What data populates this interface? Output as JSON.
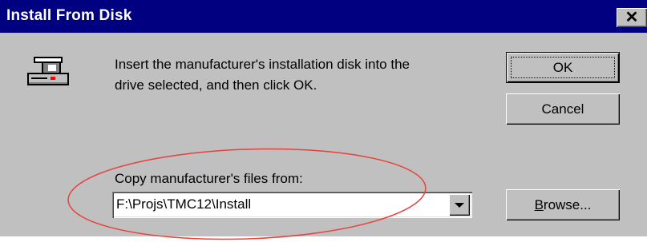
{
  "dialog": {
    "title": "Install From Disk",
    "close_label": "✕"
  },
  "message": "Insert the manufacturer's installation disk into the\ndrive selected, and then click OK.",
  "buttons": {
    "ok": "OK",
    "cancel": "Cancel",
    "browse_underlined": "B",
    "browse_rest": "rowse..."
  },
  "copy_from": {
    "label": "Copy manufacturer's files from:",
    "value": "F:\\Projs\\TMC12\\Install"
  },
  "icons": [
    "disk-drive-icon",
    "close-icon",
    "dropdown-arrow-icon"
  ],
  "colors": {
    "titlebar": "#000080",
    "dialog_bg": "#c0c0c0",
    "annotation_ellipse": "#e8403a"
  }
}
